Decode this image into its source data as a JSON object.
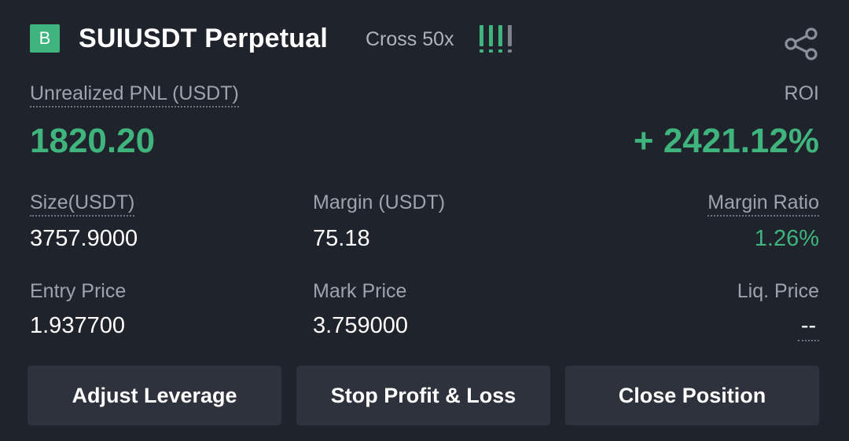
{
  "header": {
    "side_badge": "B",
    "symbol": "SUIUSDT Perpetual",
    "margin_mode": "Cross 50x",
    "risk_level": 3,
    "risk_bars_total": 4,
    "share_icon": "share-icon"
  },
  "pnl": {
    "label": "Unrealized PNL (USDT)",
    "value": "1820.20",
    "roi_label": "ROI",
    "roi_value": "+ 2421.12%"
  },
  "stats": {
    "size_label": "Size(USDT)",
    "size_value": "3757.9000",
    "margin_label": "Margin (USDT)",
    "margin_value": "75.18",
    "margin_ratio_label": "Margin Ratio",
    "margin_ratio_value": "1.26%",
    "entry_price_label": "Entry Price",
    "entry_price_value": "1.937700",
    "mark_price_label": "Mark Price",
    "mark_price_value": "3.759000",
    "liq_price_label": "Liq. Price",
    "liq_price_value": "--"
  },
  "actions": {
    "adjust_leverage": "Adjust Leverage",
    "stop_profit_loss": "Stop Profit & Loss",
    "close_position": "Close Position"
  },
  "colors": {
    "background": "#1f232b",
    "profit_green": "#3fb47d",
    "muted_text": "#9ea3ad",
    "button_bg": "#2d323c",
    "risk_inactive": "#7c828c"
  }
}
